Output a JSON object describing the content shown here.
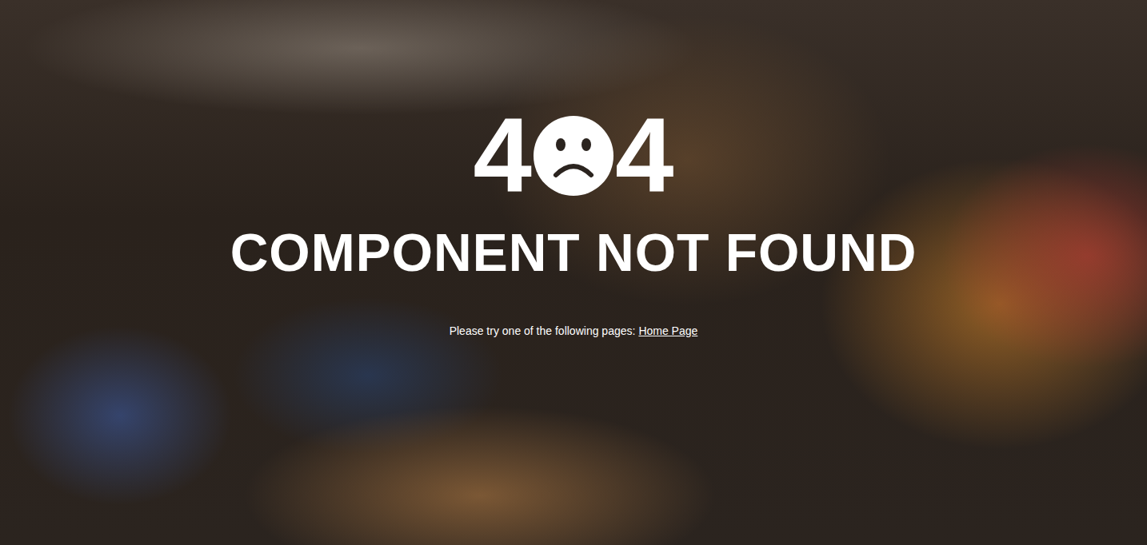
{
  "error": {
    "code": {
      "left": "4",
      "right": "4"
    },
    "title": "COMPONENT NOT FOUND",
    "message": "Please try one of the following pages:",
    "links": [
      {
        "label": "Home Page"
      }
    ]
  }
}
